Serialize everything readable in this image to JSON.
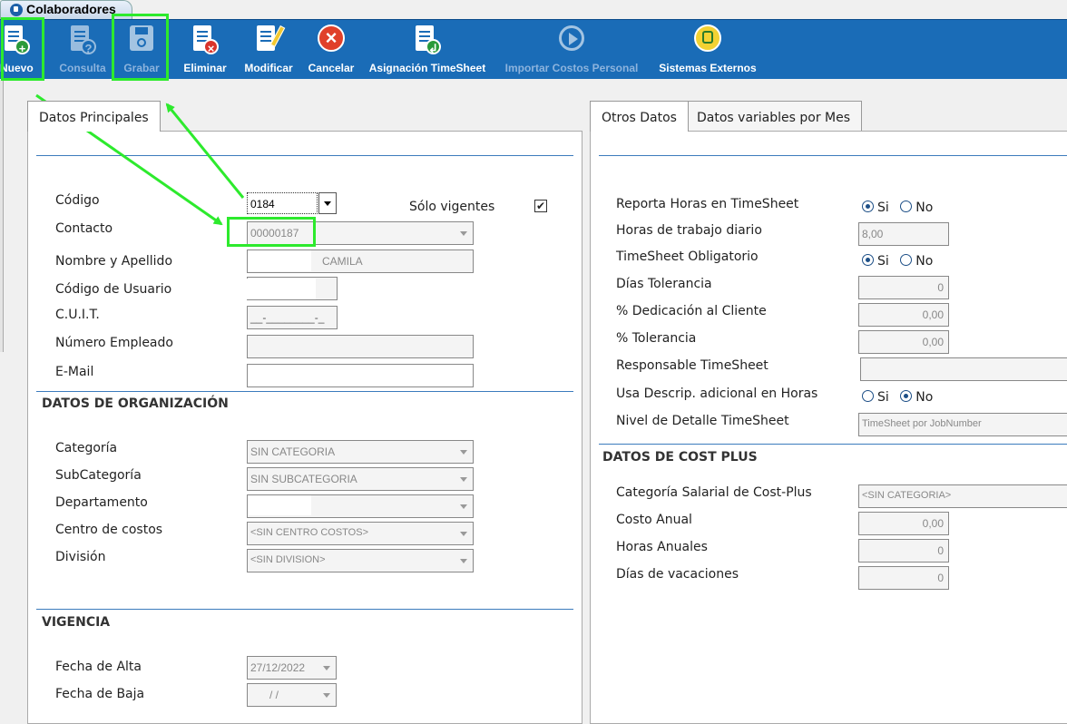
{
  "window": {
    "tab_title": "Colaboradores"
  },
  "toolbar": {
    "buttons": [
      {
        "label": "Nuevo",
        "icon": "add-doc-icon",
        "enabled": true
      },
      {
        "label": "Consulta",
        "icon": "query-doc-icon",
        "enabled": false
      },
      {
        "label": "Grabar",
        "icon": "floppy-disk-icon",
        "enabled": false
      },
      {
        "label": "Eliminar",
        "icon": "delete-doc-icon",
        "enabled": true
      },
      {
        "label": "Modificar",
        "icon": "edit-doc-icon",
        "enabled": true
      },
      {
        "label": "Cancelar",
        "icon": "cancel-icon",
        "enabled": true
      },
      {
        "label": "Asignación TimeSheet",
        "icon": "assign-doc-icon",
        "enabled": true
      },
      {
        "label": "Importar Costos Personal",
        "icon": "play-import-icon",
        "enabled": false
      },
      {
        "label": "Sistemas Externos",
        "icon": "external-systems-icon",
        "enabled": true
      }
    ]
  },
  "left": {
    "tab": "Datos Principales",
    "fields": {
      "codigo": {
        "label": "Código",
        "value": "0184"
      },
      "solo_vigentes": {
        "label": "Sólo vigentes",
        "checked": true
      },
      "contacto": {
        "label": "Contacto",
        "value": "00000187"
      },
      "nombre": {
        "label": "Nombre y Apellido",
        "value": "CAMILA"
      },
      "usuario": {
        "label": "Código de Usuario",
        "value": ""
      },
      "cuit": {
        "label": "C.U.I.T.",
        "value": "__-________-_"
      },
      "empleado": {
        "label": "Número Empleado",
        "value": ""
      },
      "email": {
        "label": "E-Mail",
        "value": ""
      }
    },
    "org": {
      "title": "DATOS DE ORGANIZACIÓN",
      "categoria": {
        "label": "Categoría",
        "value": "SIN CATEGORIA"
      },
      "subcategoria": {
        "label": "SubCategoría",
        "value": "SIN SUBCATEGORIA"
      },
      "departamento": {
        "label": "Departamento",
        "value": ""
      },
      "centro": {
        "label": "Centro de costos",
        "value": "<SIN CENTRO COSTOS>"
      },
      "division": {
        "label": "División",
        "value": "<SIN DIVISION>"
      }
    },
    "vigencia": {
      "title": "VIGENCIA",
      "alta": {
        "label": "Fecha de Alta",
        "value": "27/12/2022"
      },
      "baja": {
        "label": "Fecha de Baja",
        "value": "/ /"
      }
    }
  },
  "right": {
    "tabs": [
      "Otros Datos",
      "Datos variables por Mes"
    ],
    "timesheet": {
      "reporta": {
        "label": "Reporta Horas en TimeSheet",
        "value": "Si"
      },
      "horas_diario": {
        "label": "Horas de trabajo diario",
        "value": "8,00"
      },
      "obligatorio": {
        "label": "TimeSheet Obligatorio",
        "value": "Si"
      },
      "dias_tol": {
        "label": "Días Tolerancia",
        "value": "0"
      },
      "dedicacion": {
        "label": "% Dedicación al Cliente",
        "value": "0,00"
      },
      "tolerancia": {
        "label": "% Tolerancia",
        "value": "0,00"
      },
      "responsable": {
        "label": "Responsable TimeSheet",
        "value": ""
      },
      "usa_descrip": {
        "label": "Usa Descrip. adicional en Horas",
        "value": "No"
      },
      "nivel": {
        "label": "Nivel de Detalle TimeSheet",
        "value": "TimeSheet por JobNumber"
      },
      "opt_si": "Si",
      "opt_no": "No"
    },
    "costplus": {
      "title": "DATOS DE COST PLUS",
      "categoria": {
        "label": "Categoría Salarial de Cost-Plus",
        "value": "<SIN CATEGORIA>"
      },
      "costo": {
        "label": "Costo Anual",
        "value": "0,00"
      },
      "horas": {
        "label": "Horas Anuales",
        "value": "0"
      },
      "vacaciones": {
        "label": "Días de vacaciones",
        "value": "0"
      }
    }
  },
  "colors": {
    "toolbar": "#1a6cb7",
    "highlight": "#2dea2d",
    "section_rule": "#3c7bbd"
  }
}
